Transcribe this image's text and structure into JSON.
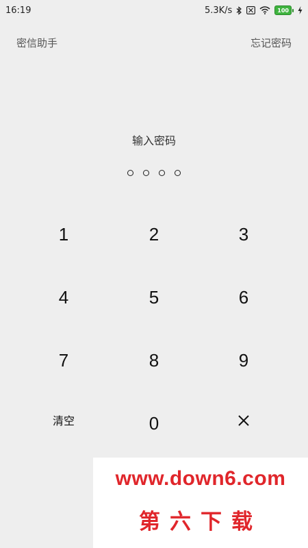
{
  "status_bar": {
    "time": "16:19",
    "network_speed": "5.3K/s",
    "battery": "100",
    "icons": [
      "bluetooth-icon",
      "sim-blocked-icon",
      "wifi-icon",
      "battery-icon",
      "charging-icon"
    ]
  },
  "header": {
    "app_name": "密信助手",
    "forgot_password": "忘记密码"
  },
  "prompt": "输入密码",
  "pin": {
    "length": 4,
    "entered": 0
  },
  "keypad": {
    "k1": "1",
    "k2": "2",
    "k3": "3",
    "k4": "4",
    "k5": "5",
    "k6": "6",
    "k7": "7",
    "k8": "8",
    "k9": "9",
    "clear": "清空",
    "k0": "0",
    "delete": "×"
  },
  "watermark": {
    "url": "www.down6.com",
    "name": "第六下载"
  },
  "colors": {
    "background": "#eeeeee",
    "watermark_red": "#e0262b",
    "battery_green": "#3fb33f"
  }
}
